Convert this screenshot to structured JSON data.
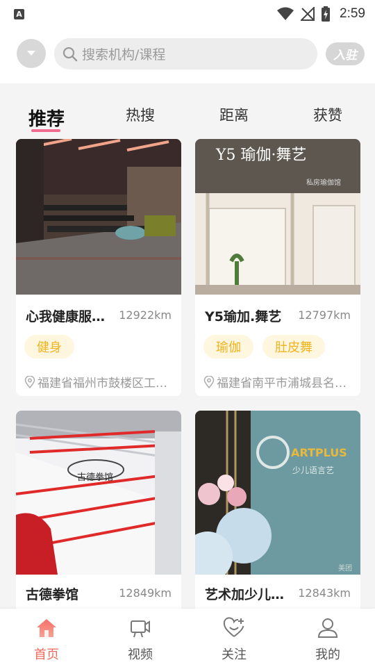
{
  "status_bar": {
    "left_icon": "A",
    "time": "2:59"
  },
  "search": {
    "placeholder": "搜索机构/课程",
    "join_label": "入驻"
  },
  "tabs": [
    "推荐",
    "热搜",
    "距离",
    "获赞"
  ],
  "cards": [
    {
      "name": "心我健康服…",
      "distance": "12922km",
      "tags": [
        "健身"
      ],
      "address": "福建省福州市鼓楼区工…"
    },
    {
      "name": "Y5瑜加.舞艺",
      "distance": "12797km",
      "tags": [
        "瑜伽",
        "肚皮舞"
      ],
      "address": "福建省南平市浦城县名…",
      "photo_sign": "Y5 瑜伽·舞艺",
      "photo_sub": "私房瑜伽馆"
    },
    {
      "name": "古德拳馆",
      "distance": "12849km",
      "tags": [],
      "address": "",
      "photo_sign": "古德拳馆"
    },
    {
      "name": "艺术加少儿…",
      "distance": "12843km",
      "tags": [],
      "address": "",
      "photo_sign": "ARTPLUS",
      "photo_sub": "少儿语言艺",
      "photo_mark": "美团"
    }
  ],
  "bottom_nav": [
    {
      "label": "首页",
      "icon": "home-icon",
      "active": true
    },
    {
      "label": "视频",
      "icon": "video-icon",
      "active": false
    },
    {
      "label": "关注",
      "icon": "heart-plus-icon",
      "active": false
    },
    {
      "label": "我的",
      "icon": "user-icon",
      "active": false
    }
  ],
  "colors": {
    "accent_pink": "#f06b8f",
    "nav_active": "#f06b5b",
    "tag_text": "#f3b31c",
    "tag_bg": "#fef6de"
  }
}
